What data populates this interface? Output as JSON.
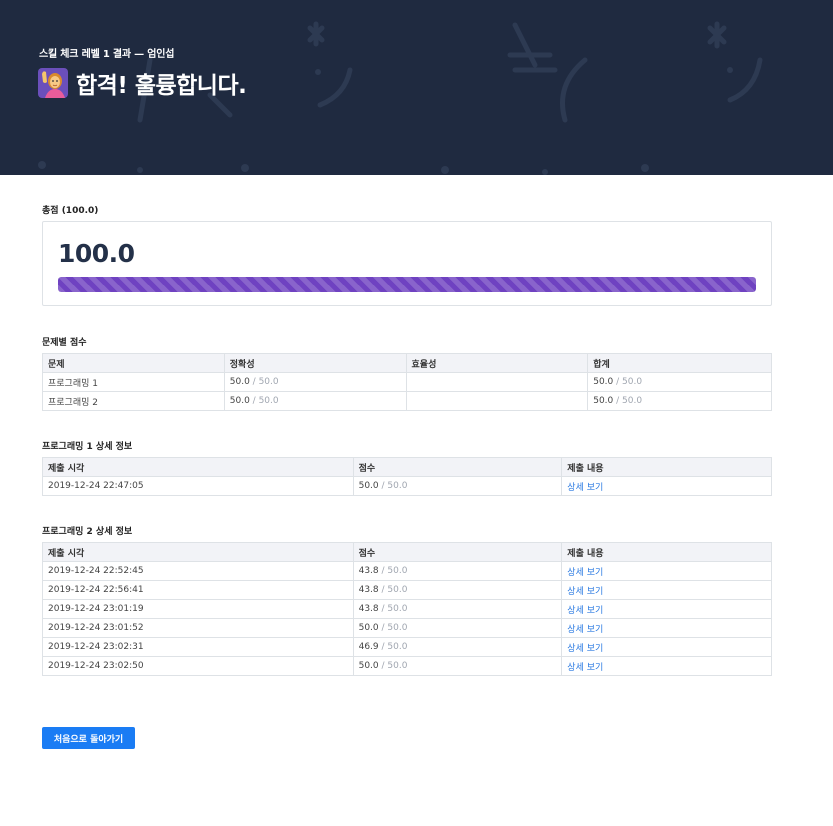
{
  "header": {
    "subtitle": "스킬 체크 레벨 1 결과 — 엄인섭",
    "title": "합격! 훌륭합니다.",
    "emoji_icon": "person-raising-hand-icon"
  },
  "total": {
    "label": "총점 (100.0)",
    "value": "100.0",
    "progress_fraction": 1.0,
    "bar_color": "#6f42c1"
  },
  "problem_scores": {
    "label": "문제별 점수",
    "headers": [
      "문제",
      "정확성",
      "효율성",
      "합계"
    ],
    "rows": [
      {
        "name": "프로그래밍 1",
        "accuracy": "50.0",
        "accuracy_max": " / 50.0",
        "efficiency": "",
        "total": "50.0",
        "total_max": " / 50.0"
      },
      {
        "name": "프로그래밍 2",
        "accuracy": "50.0",
        "accuracy_max": " / 50.0",
        "efficiency": "",
        "total": "50.0",
        "total_max": " / 50.0"
      }
    ]
  },
  "detail1": {
    "label": "프로그래밍 1 상세 정보",
    "headers": [
      "제출 시각",
      "점수",
      "제출 내용"
    ],
    "rows": [
      {
        "time": "2019-12-24 22:47:05",
        "score": "50.0",
        "max": " / 50.0",
        "link": "상세 보기"
      }
    ]
  },
  "detail2": {
    "label": "프로그래밍 2 상세 정보",
    "headers": [
      "제출 시각",
      "점수",
      "제출 내용"
    ],
    "rows": [
      {
        "time": "2019-12-24 22:52:45",
        "score": "43.8",
        "max": " / 50.0",
        "link": "상세 보기"
      },
      {
        "time": "2019-12-24 22:56:41",
        "score": "43.8",
        "max": " / 50.0",
        "link": "상세 보기"
      },
      {
        "time": "2019-12-24 23:01:19",
        "score": "43.8",
        "max": " / 50.0",
        "link": "상세 보기"
      },
      {
        "time": "2019-12-24 23:01:52",
        "score": "50.0",
        "max": " / 50.0",
        "link": "상세 보기"
      },
      {
        "time": "2019-12-24 23:02:31",
        "score": "46.9",
        "max": " / 50.0",
        "link": "상세 보기"
      },
      {
        "time": "2019-12-24 23:02:50",
        "score": "50.0",
        "max": " / 50.0",
        "link": "상세 보기"
      }
    ]
  },
  "home_button": "처음으로 돌아가기",
  "colors": {
    "header_bg": "#1f2a40",
    "link": "#2a7ae2",
    "button": "#1a7cf4"
  }
}
